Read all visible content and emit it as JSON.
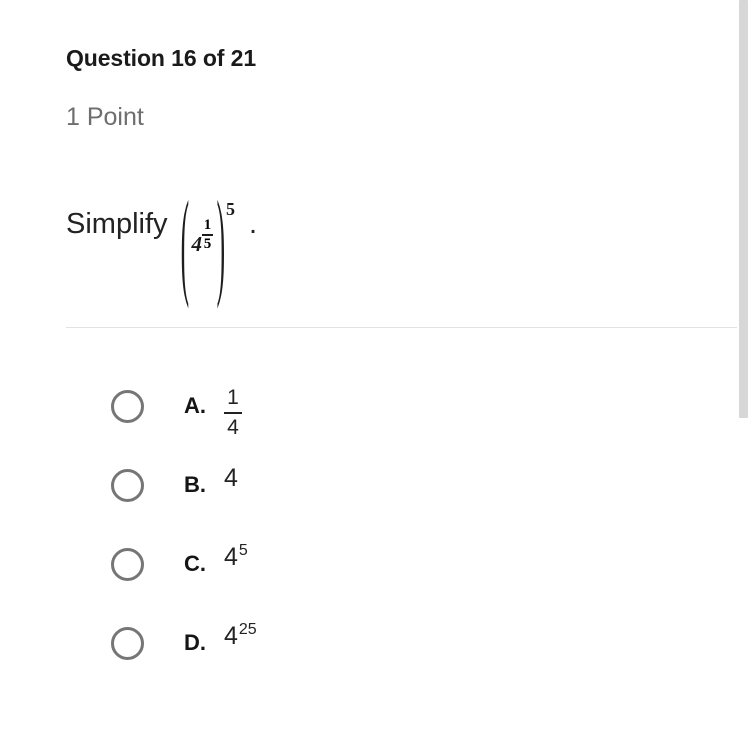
{
  "header": {
    "question_title": "Question 16 of 21",
    "point_value": "1 Point"
  },
  "prompt": {
    "lead_text": "Simplify",
    "trailing_period": ".",
    "expression": {
      "open_paren": "(",
      "close_paren": ")",
      "base": "4",
      "exponent_numerator": "1",
      "exponent_denominator": "5",
      "outer_exponent": "5",
      "plain_text": "(4^(1/5))^5"
    }
  },
  "options": [
    {
      "letter": "A.",
      "value_type": "fraction",
      "numerator": "1",
      "denominator": "4",
      "plain_text": "1/4",
      "selected": false
    },
    {
      "letter": "B.",
      "value_type": "plain",
      "base": "4",
      "exponent": "",
      "plain_text": "4",
      "selected": false
    },
    {
      "letter": "C.",
      "value_type": "power",
      "base": "4",
      "exponent": "5",
      "plain_text": "4^5",
      "selected": false
    },
    {
      "letter": "D.",
      "value_type": "power",
      "base": "4",
      "exponent": "25",
      "plain_text": "4^25",
      "selected": false
    }
  ],
  "colors": {
    "background": "#ffffff",
    "title_text": "#1a1a1a",
    "muted_text": "#6e6e6e",
    "body_text": "#232323",
    "divider": "#e2e2e2",
    "radio_border": "#767676",
    "scrollbar_thumb": "#d7d7d7"
  },
  "scrollbar": {
    "orientation": "vertical",
    "thumb_top_px": "0",
    "thumb_height_px": "418"
  }
}
